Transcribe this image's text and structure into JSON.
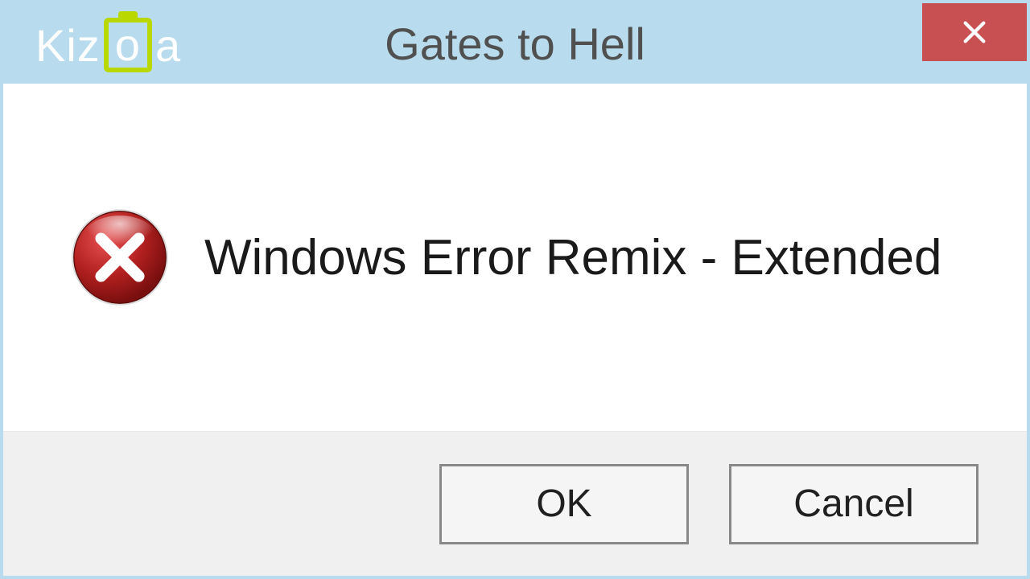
{
  "window": {
    "title": "Gates to Hell",
    "watermark_pre": "Kiz",
    "watermark_mid": "o",
    "watermark_post": "a"
  },
  "message": "Windows Error Remix - Extended",
  "buttons": {
    "ok": "OK",
    "cancel": "Cancel"
  },
  "colors": {
    "chrome": "#b8dced",
    "close": "#c95052",
    "error_icon": "#b01f1f"
  }
}
